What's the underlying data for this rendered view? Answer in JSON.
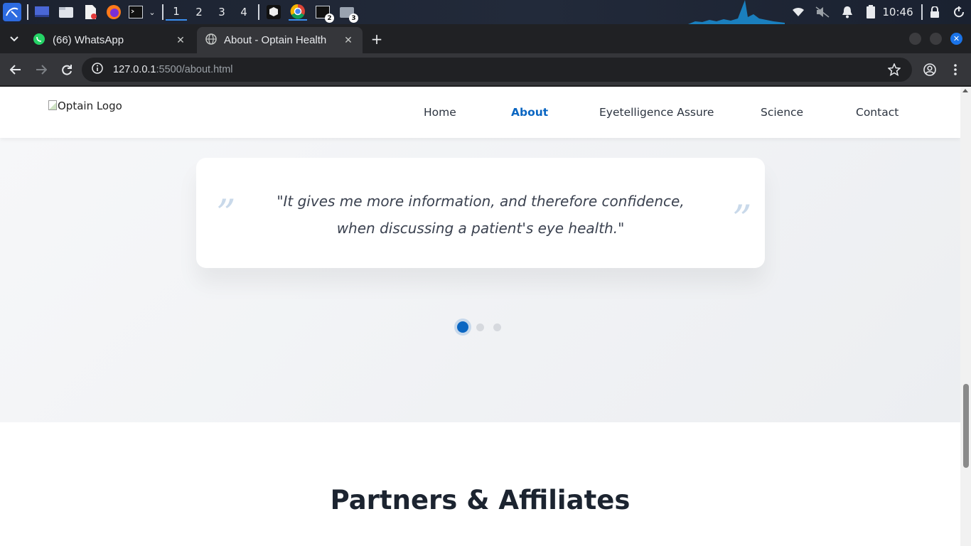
{
  "taskbar": {
    "workspaces": [
      "1",
      "2",
      "3",
      "4"
    ],
    "terminal_badge": "2",
    "files_badge": "3",
    "clock": "10:46"
  },
  "browser": {
    "tabs": [
      {
        "title": "(66) WhatsApp",
        "icon": "whatsapp-icon"
      },
      {
        "title": "About - Optain Health",
        "icon": "globe-icon"
      }
    ],
    "url_host": "127.0.0.1",
    "url_rest": ":5500/about.html"
  },
  "site": {
    "logo_alt": "Optain Logo",
    "nav": [
      {
        "label": "Home"
      },
      {
        "label": "About",
        "active": true
      },
      {
        "label": "Eyetelligence Assure"
      },
      {
        "label": "Science"
      },
      {
        "label": "Contact"
      }
    ],
    "testimonial": {
      "quote": "\"It gives me more information, and therefore confidence, when discussing a patient's eye health.\"",
      "open_mark": "”",
      "close_mark": "”",
      "slide_count": 3,
      "active_slide": 1
    },
    "partners_title": "Partners & Affiliates"
  },
  "colors": {
    "accent": "#0a66c2",
    "quote_mark": "#c9d9ea",
    "text": "#3b4250"
  }
}
